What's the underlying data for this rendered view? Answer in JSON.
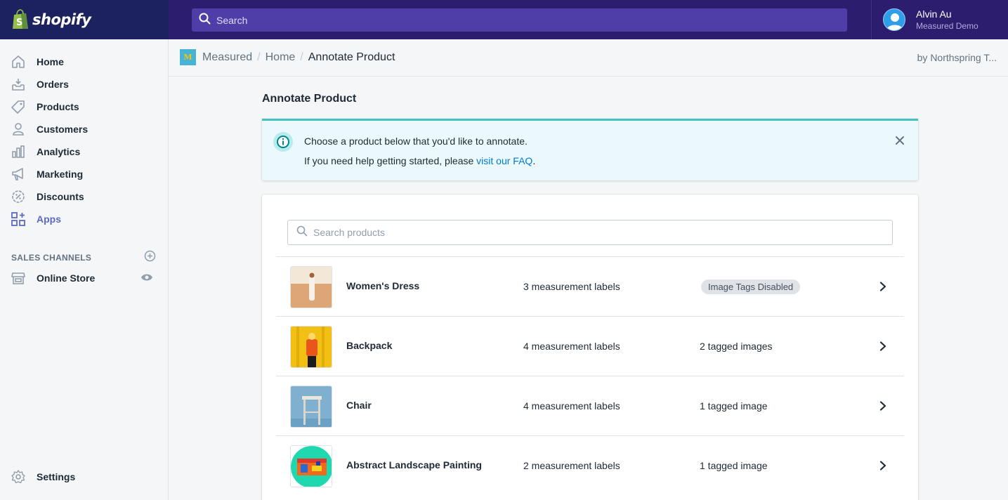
{
  "topbar": {
    "brand": "shopify",
    "search_placeholder": "Search",
    "user_name": "Alvin Au",
    "store_name": "Measured Demo"
  },
  "sidebar": {
    "items": [
      {
        "label": "Home",
        "icon": "home-icon"
      },
      {
        "label": "Orders",
        "icon": "orders-icon"
      },
      {
        "label": "Products",
        "icon": "tag-icon"
      },
      {
        "label": "Customers",
        "icon": "person-icon"
      },
      {
        "label": "Analytics",
        "icon": "bar-chart-icon"
      },
      {
        "label": "Marketing",
        "icon": "megaphone-icon"
      },
      {
        "label": "Discounts",
        "icon": "discount-icon"
      },
      {
        "label": "Apps",
        "icon": "apps-icon",
        "active": true
      }
    ],
    "sales_channels_heading": "SALES CHANNELS",
    "online_store": "Online Store",
    "settings": "Settings"
  },
  "appbar": {
    "app_logo_letter": "M",
    "crumbs": [
      "Measured",
      "Home",
      "Annotate Product"
    ],
    "byline": "by Northspring T..."
  },
  "page": {
    "title": "Annotate Product"
  },
  "banner": {
    "line1": "Choose a product below that you'd like to annotate.",
    "line2_prefix": "If you need help getting started, please ",
    "line2_link": "visit our FAQ",
    "line2_suffix": "."
  },
  "products": {
    "search_placeholder": "Search products",
    "rows": [
      {
        "name": "Women's Dress",
        "measurements": "3 measurement labels",
        "tags": "Image Tags Disabled",
        "tags_is_badge": true
      },
      {
        "name": "Backpack",
        "measurements": "4 measurement labels",
        "tags": "2 tagged images",
        "tags_is_badge": false
      },
      {
        "name": "Chair",
        "measurements": "4 measurement labels",
        "tags": "1 tagged image",
        "tags_is_badge": false
      },
      {
        "name": "Abstract Landscape Painting",
        "measurements": "2 measurement labels",
        "tags": "1 tagged image",
        "tags_is_badge": false
      }
    ]
  },
  "colors": {
    "topbar": "#1c2260",
    "accent": "#5c6ac4",
    "banner_bg": "#ebf9fc",
    "banner_border": "#47c1bf",
    "link": "#007ace"
  }
}
